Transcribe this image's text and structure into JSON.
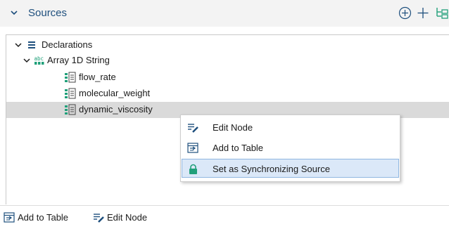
{
  "header": {
    "title": "Sources"
  },
  "tree": {
    "root": {
      "label": "Declarations"
    },
    "group": {
      "label": "Array 1D String",
      "icon_text": "abc"
    },
    "items": [
      {
        "label": "flow_rate"
      },
      {
        "label": "molecular_weight"
      },
      {
        "label": "dynamic_viscosity"
      }
    ]
  },
  "context_menu": {
    "items": [
      {
        "label": "Edit Node",
        "icon": "edit-node-icon"
      },
      {
        "label": "Add to Table",
        "icon": "add-to-table-icon"
      },
      {
        "label": "Set as Synchronizing Source",
        "icon": "lock-icon"
      }
    ]
  },
  "bottom_toolbar": {
    "add_to_table": "Add to Table",
    "edit_node": "Edit Node"
  },
  "colors": {
    "accent": "#1e4f7d",
    "icon_green": "#21a07a",
    "selection": "#dadada",
    "menu_highlight": "#dbe8f8"
  }
}
